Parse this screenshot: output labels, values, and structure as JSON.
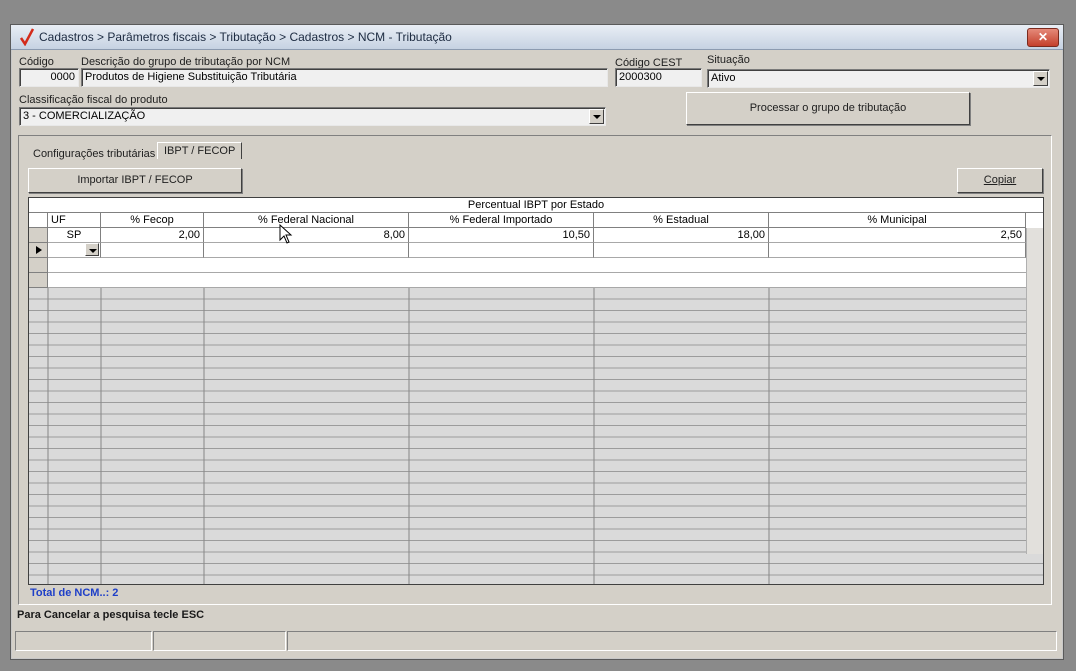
{
  "window": {
    "title": "Cadastros > Parâmetros fiscais > Tributação > Cadastros > NCM - Tributação",
    "close_label": "✕"
  },
  "form": {
    "codigo_label": "Código",
    "codigo_value": "0000",
    "descricao_label": "Descrição do grupo de tributação por NCM",
    "descricao_value": "Produtos de Higiene Substituição Tributária",
    "cest_label": "Código CEST",
    "cest_value": "2000300",
    "situacao_label": "Situação",
    "situacao_value": "Ativo",
    "classificacao_label": "Classificação fiscal do produto",
    "classificacao_value": "3 - COMERCIALIZAÇÃO",
    "processar_label": "Processar o grupo de tributação"
  },
  "tabs": [
    {
      "label": "Configurações tributárias"
    },
    {
      "label": "IBPT / FECOP"
    }
  ],
  "toolbar": {
    "importar_label": "Importar IBPT / FECOP",
    "copiar_label": "Copiar"
  },
  "grid": {
    "caption": "Percentual IBPT por Estado",
    "columns": [
      "UF",
      "% Fecop",
      "% Federal Nacional",
      "% Federal Importado",
      "% Estadual",
      "% Municipal"
    ],
    "rows": [
      {
        "uf": "SP",
        "fecop": "2,00",
        "federal_nacional": "8,00",
        "federal_importado": "10,50",
        "estadual": "18,00",
        "municipal": "2,50"
      }
    ]
  },
  "footer": {
    "total_label": "Total de NCM..: 2",
    "status_text": "Para Cancelar a pesquisa tecle ESC"
  }
}
